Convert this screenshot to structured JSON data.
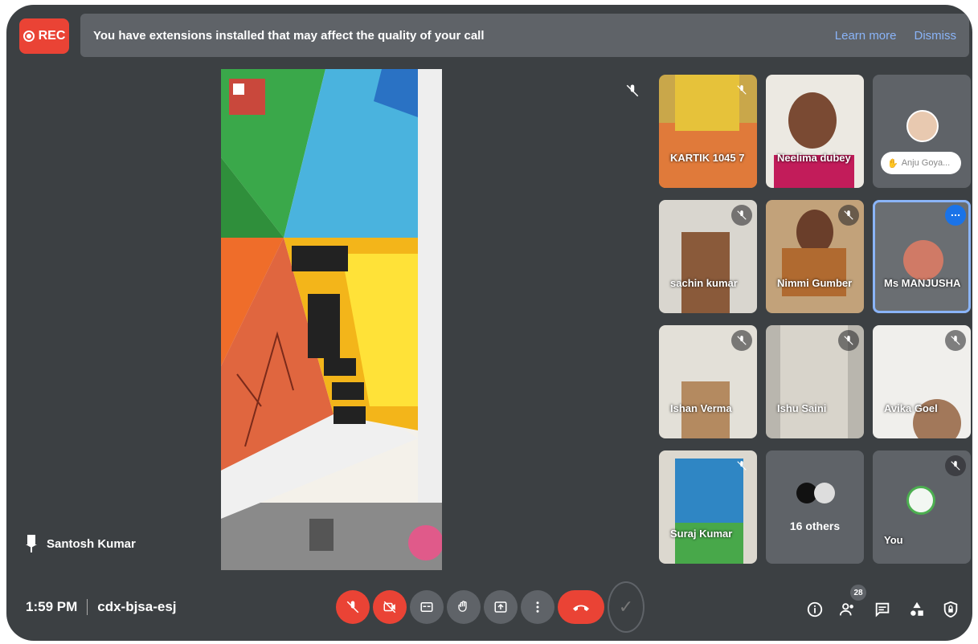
{
  "banner": {
    "rec_label": "REC",
    "message": "You have extensions installed that may affect the quality of your call",
    "learn_more": "Learn more",
    "dismiss": "Dismiss"
  },
  "presenter": {
    "name": "Santosh Kumar",
    "icon": "pin-icon"
  },
  "meeting": {
    "time": "1:59 PM",
    "code": "cdx-bjsa-esj"
  },
  "participants": {
    "count": "28",
    "tiles": [
      {
        "name": "KARTIK 1045 7"
      },
      {
        "name": "Neelima dubey"
      },
      {
        "name": "Anju Goya..."
      },
      {
        "name": "sachin kumar"
      },
      {
        "name": "Nimmi Gumber"
      },
      {
        "name": "Ms MANJUSHA"
      },
      {
        "name": "Ishan Verma"
      },
      {
        "name": "Ishu Saini"
      },
      {
        "name": "Avika Goel"
      },
      {
        "name": "Suraj Kumar"
      },
      {
        "name": "16 others"
      },
      {
        "name": "You"
      }
    ]
  },
  "colors": {
    "background": "#3c4043",
    "tile": "#5f6368",
    "danger": "#ea4335",
    "link": "#8ab4f8"
  }
}
